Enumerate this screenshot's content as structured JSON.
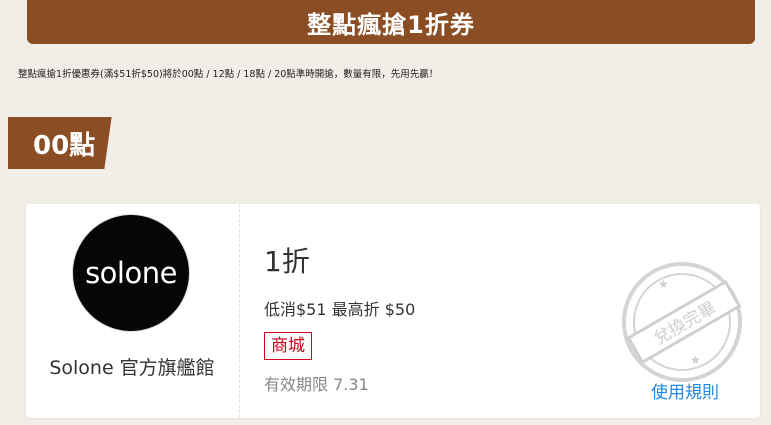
{
  "header": {
    "title": "整點瘋搶1折券"
  },
  "notice": "整點瘋搶1折優惠券(滿$51折$50)將於00點 / 12點 / 18點 / 20點準時開搶，數量有限，先用先贏！",
  "time_slot": {
    "label": "00點"
  },
  "coupon": {
    "logo_text": "solone",
    "shop_name": "Solone 官方旗艦館",
    "discount": "1折",
    "condition": "低消$51 最高折 $50",
    "badge": "商城",
    "validity": "有效期限 7.31",
    "stamp_text": "兌換完畢",
    "rules_label": "使用規則"
  },
  "colors": {
    "brand_brown": "#8b4d23",
    "background": "#f1ede7",
    "badge_red": "#d0011b",
    "link_blue": "#1e88e5"
  }
}
